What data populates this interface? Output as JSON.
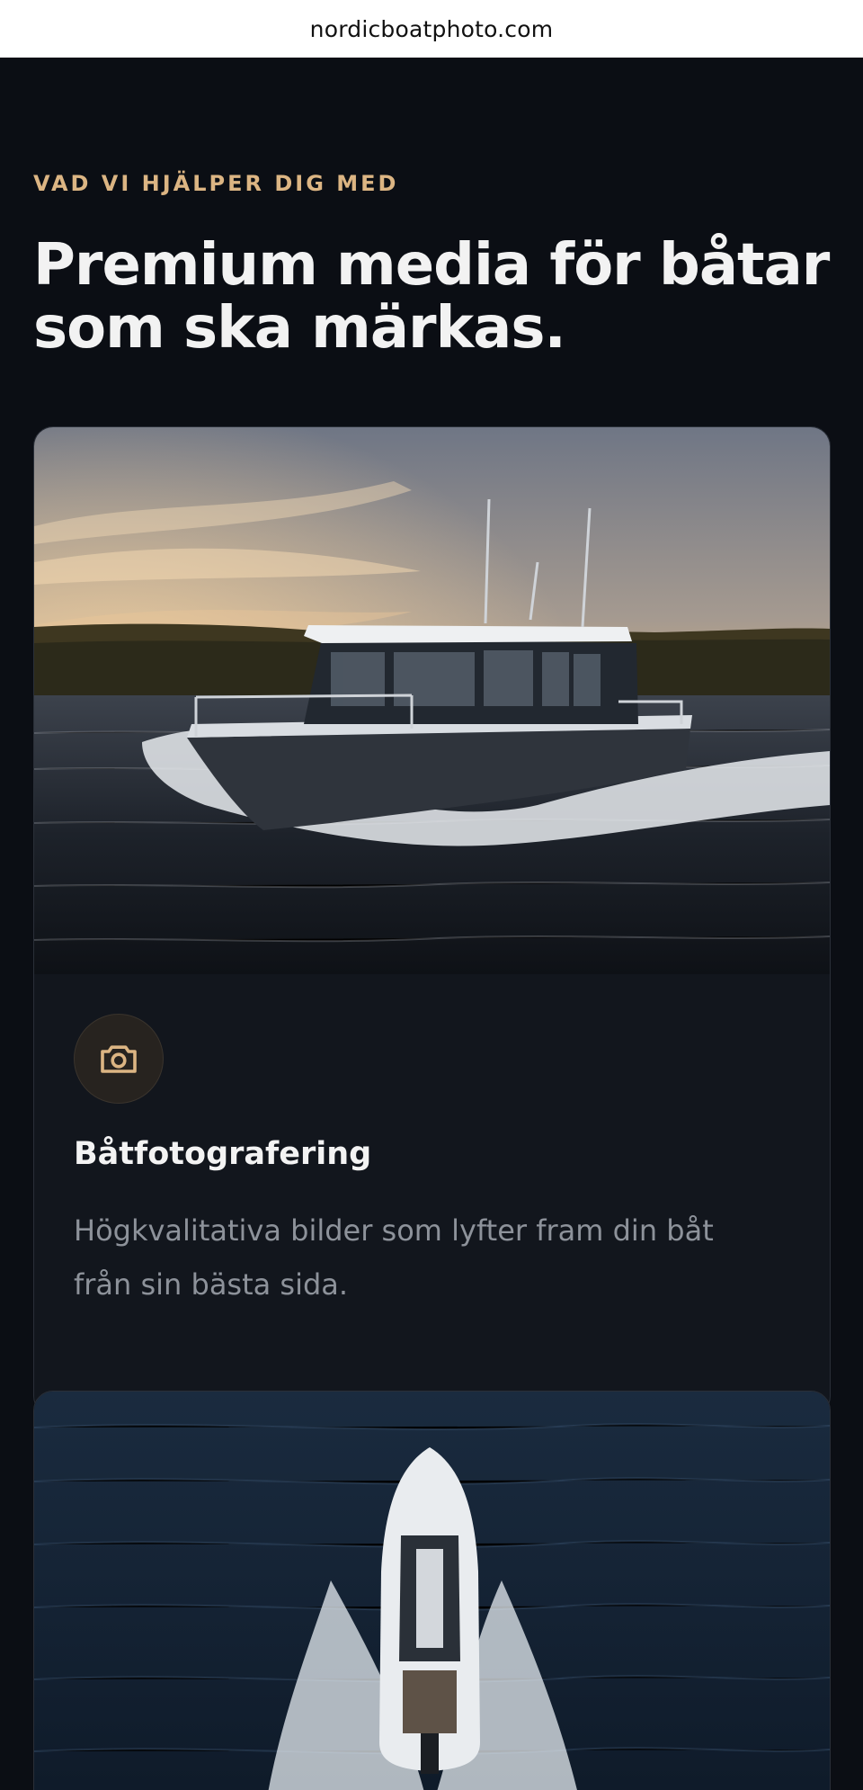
{
  "browser": {
    "url": "nordicboatphoto.com"
  },
  "section": {
    "eyebrow": "VAD VI HJÄLPER DIG MED",
    "headline_line1": "Premium media för båtar",
    "headline_line2": "som ska märkas."
  },
  "cards": [
    {
      "icon": "camera-icon",
      "title": "Båtfotografering",
      "description": "Högkvalitativa bilder som lyfter fram din båt från sin bästa sida."
    }
  ],
  "colors": {
    "background": "#0b0e14",
    "accent": "#dcb583",
    "card": "#12161d",
    "heading": "#f2f2f2",
    "muted": "#8d929a"
  }
}
